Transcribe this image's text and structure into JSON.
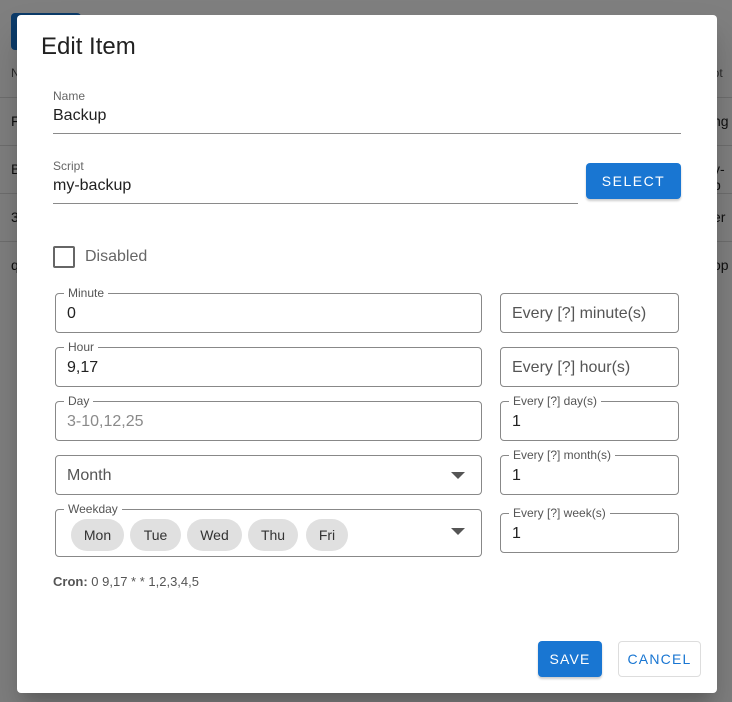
{
  "background": {
    "header_fragments": [
      "N",
      "ript"
    ],
    "rows": [
      {
        "left": "F",
        "right": "ng"
      },
      {
        "left": "B",
        "right": "y-b"
      },
      {
        "left": "3",
        "right": "er"
      },
      {
        "left": "q",
        "right": "op"
      }
    ]
  },
  "dialog": {
    "title": "Edit Item",
    "name": {
      "label": "Name",
      "value": "Backup"
    },
    "script": {
      "label": "Script",
      "value": "my-backup"
    },
    "select_button": "SELECT",
    "disabled_label": "Disabled",
    "disabled_checked": false,
    "minute": {
      "label": "Minute",
      "value": "0",
      "every_placeholder": "Every [?] minute(s)"
    },
    "hour": {
      "label": "Hour",
      "value": "9,17",
      "every_placeholder": "Every [?] hour(s)"
    },
    "day": {
      "label": "Day",
      "value": "3-10,12,25",
      "every_label": "Every [?] day(s)",
      "every_value": "1"
    },
    "month": {
      "label": "Month",
      "every_label": "Every [?] month(s)",
      "every_value": "1"
    },
    "weekday": {
      "label": "Weekday",
      "chips": [
        "Mon",
        "Tue",
        "Wed",
        "Thu",
        "Fri"
      ],
      "every_label": "Every [?] week(s)",
      "every_value": "1"
    },
    "cron_label": "Cron:",
    "cron_value": "0 9,17 * * 1,2,3,4,5",
    "save_button": "SAVE",
    "cancel_button": "CANCEL"
  },
  "colors": {
    "primary": "#1976d2",
    "scrim": "rgba(0,0,0,0.5)"
  },
  "icons": {
    "dropdown": "arrow-drop-down-icon"
  }
}
